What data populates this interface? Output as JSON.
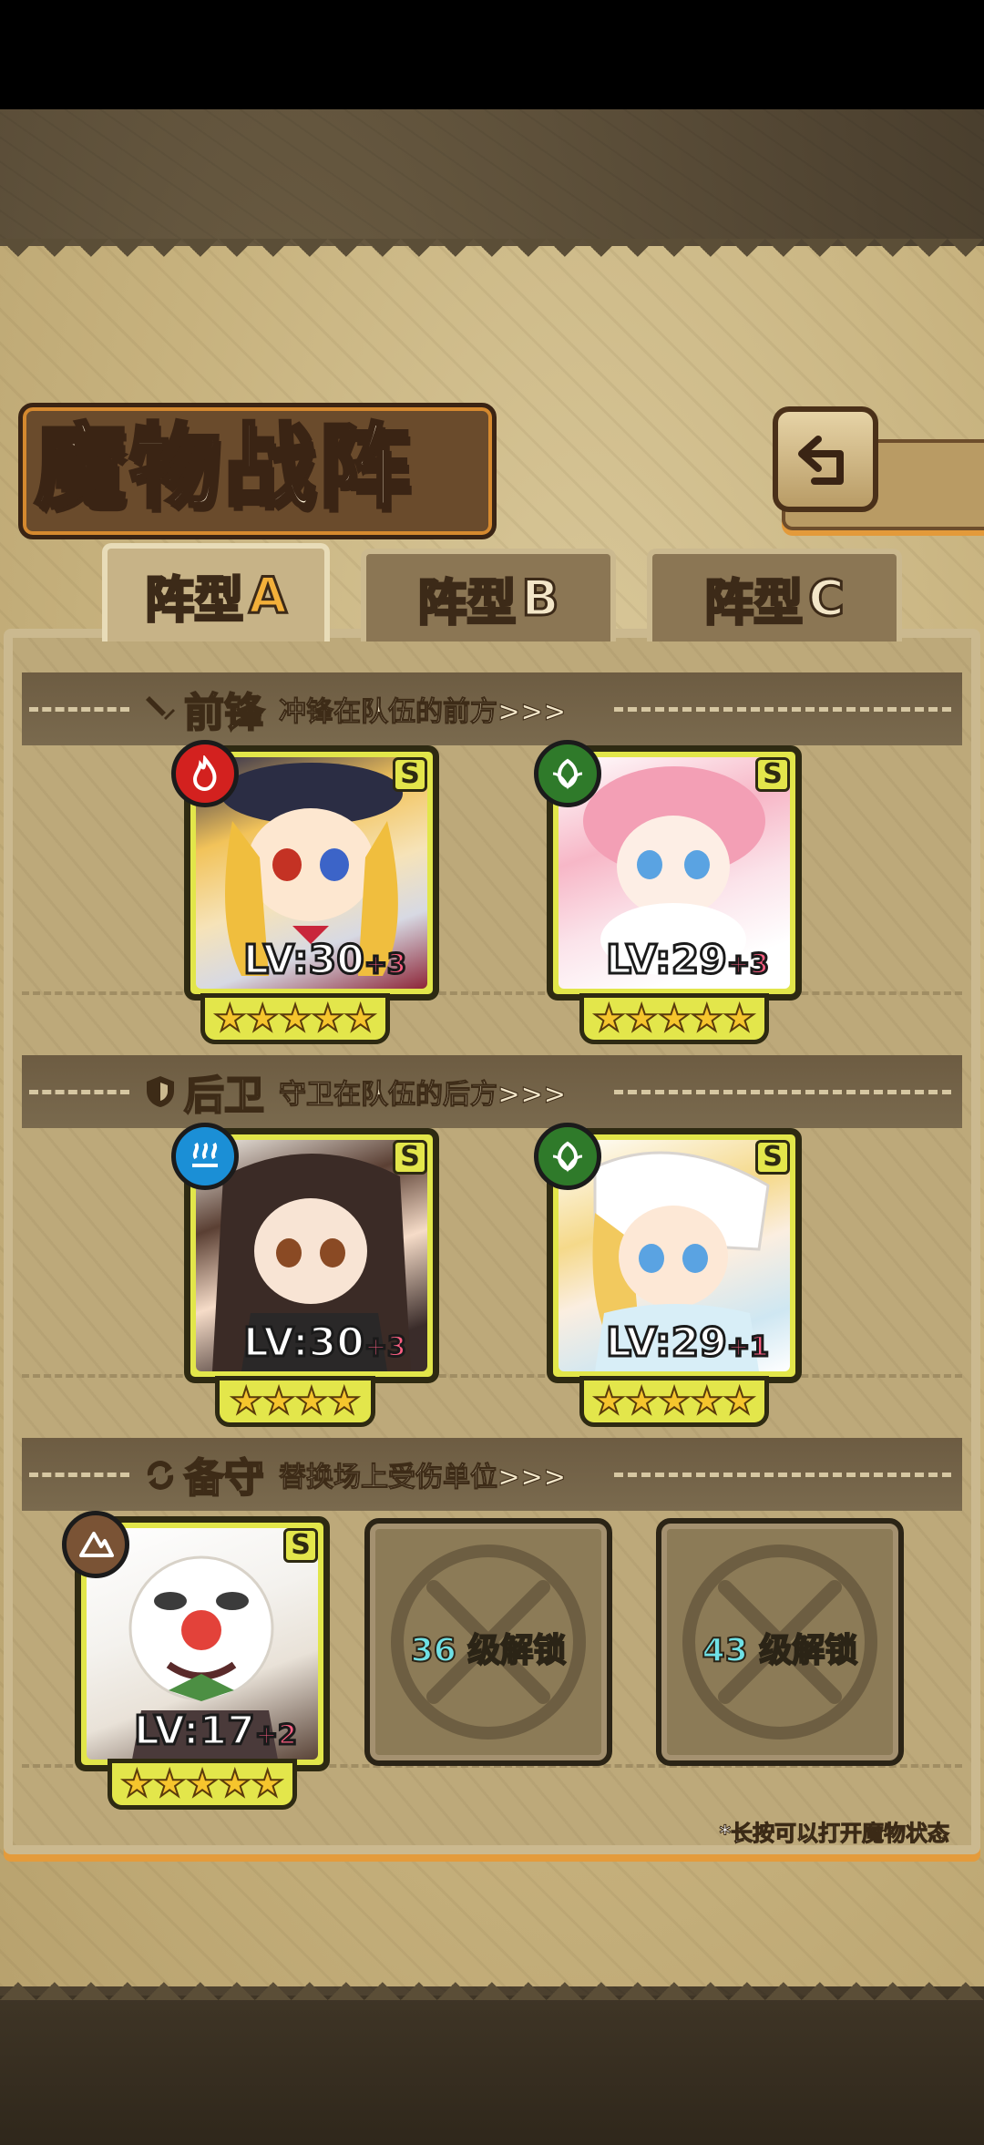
{
  "title": "魔物战阵",
  "back_icon": "return-arrow-icon",
  "tabs": [
    {
      "label": "阵型",
      "letter": "A",
      "active": true
    },
    {
      "label": "阵型",
      "letter": "B",
      "active": false
    },
    {
      "label": "阵型",
      "letter": "C",
      "active": false
    }
  ],
  "sections": {
    "vanguard": {
      "icon": "sword-icon",
      "title": "前锋",
      "desc": "冲锋在队伍的前方>>>"
    },
    "rearguard": {
      "icon": "shield-icon",
      "title": "后卫",
      "desc": "守卫在队伍的后方>>>"
    },
    "reserve": {
      "icon": "swap-icon",
      "title": "备守",
      "desc": "替换场上受伤单位>>>"
    }
  },
  "monsters": [
    {
      "slot": "vanguard-1",
      "element": "fire",
      "element_color": "#d3211f",
      "rank": "S",
      "level": "LV:30",
      "bonus": "+3",
      "stars": 5
    },
    {
      "slot": "vanguard-2",
      "element": "leaf",
      "element_color": "#2f7a2a",
      "rank": "S",
      "level": "LV:29",
      "bonus": "+3",
      "stars": 5
    },
    {
      "slot": "rearguard-1",
      "element": "water",
      "element_color": "#1b8fd6",
      "rank": "S",
      "level": "LV:30",
      "bonus": "+3",
      "stars": 4
    },
    {
      "slot": "rearguard-2",
      "element": "leaf",
      "element_color": "#2f7a2a",
      "rank": "S",
      "level": "LV:29",
      "bonus": "+1",
      "stars": 5
    },
    {
      "slot": "reserve-1",
      "element": "earth",
      "element_color": "#7a5335",
      "rank": "S",
      "level": "LV:17",
      "bonus": "+2",
      "stars": 5
    }
  ],
  "locked_slots": [
    {
      "level": "36",
      "text": "级解锁"
    },
    {
      "level": "43",
      "text": "级解锁"
    }
  ],
  "hint": "*长按可以打开魔物状态",
  "colors": {
    "accent": "#f3b03a",
    "frame": "#e3e64b",
    "bonus": "#ff5f83",
    "unlock_num": "#6fe1e6"
  }
}
